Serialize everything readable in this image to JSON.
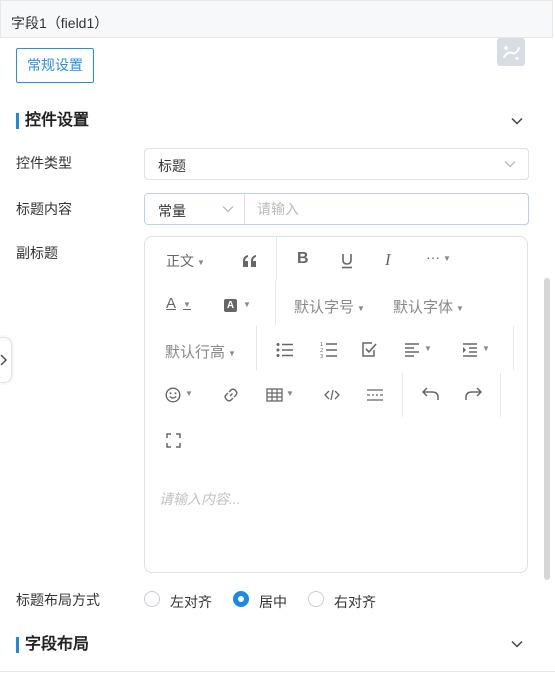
{
  "header": {
    "title": "字段1（field1）"
  },
  "tabs": {
    "general_settings": "常规设置"
  },
  "sections": {
    "control_settings": "控件设置",
    "field_layout": "字段布局"
  },
  "form": {
    "control_type": {
      "label": "控件类型",
      "value": "标题"
    },
    "title_content": {
      "label": "标题内容",
      "mode": "常量",
      "placeholder": "请输入"
    },
    "subtitle": {
      "label": "副标题"
    },
    "title_layout": {
      "label": "标题布局方式",
      "options": [
        "左对齐",
        "居中",
        "右对齐"
      ],
      "selected": "居中"
    }
  },
  "editor": {
    "placeholder": "请输入内容...",
    "toolbar": {
      "heading": "正文",
      "font_size": "默认字号",
      "font_family": "默认字体",
      "line_height": "默认行高",
      "more": "···"
    }
  }
}
